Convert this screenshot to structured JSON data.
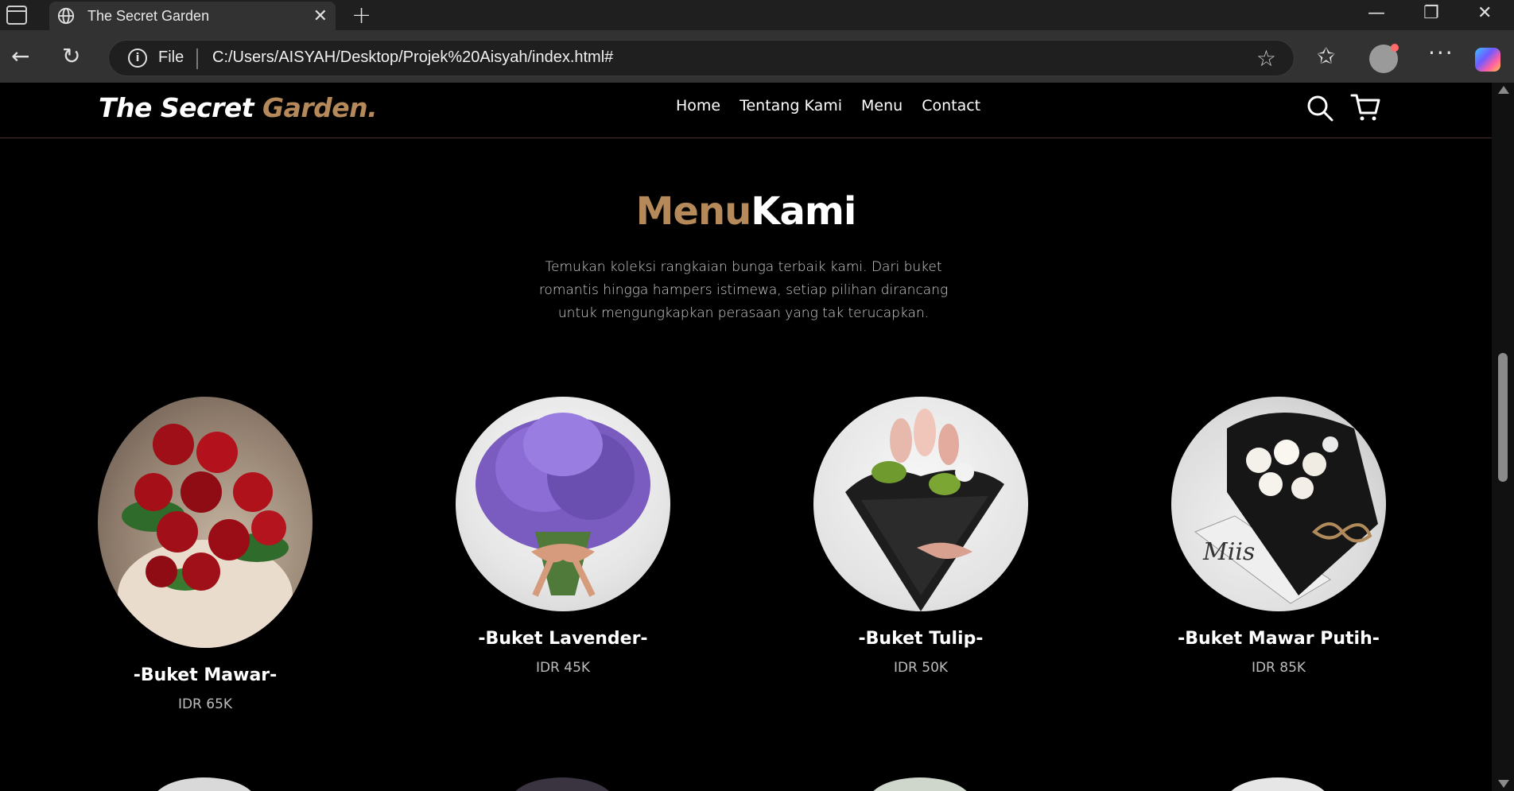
{
  "browser": {
    "tab_title": "The Secret Garden",
    "new_tab_symbol": "+",
    "file_label": "File",
    "url": "C:/Users/AISYAH/Desktop/Projek%20Aisyah/index.html#"
  },
  "site": {
    "logo_main": "The Secret ",
    "logo_accent": "Garden.",
    "nav": [
      "Home",
      "Tentang Kami",
      "Menu",
      "Contact"
    ],
    "accent_color": "#b6895b"
  },
  "menu": {
    "title_accent": "Menu",
    "title_rest": "Kami",
    "description": "Temukan koleksi rangkaian bunga terbaik kami. Dari buket romantis hingga hampers istimewa, setiap pilihan dirancang untuk mengungkapkan perasaan yang tak terucapkan.",
    "items": [
      {
        "name": "-Buket Mawar-",
        "price": "IDR 65K"
      },
      {
        "name": "-Buket Lavender-",
        "price": "IDR 45K"
      },
      {
        "name": "-Buket Tulip-",
        "price": "IDR 50K"
      },
      {
        "name": "-Buket Mawar Putih-",
        "price": "IDR 85K"
      }
    ]
  }
}
